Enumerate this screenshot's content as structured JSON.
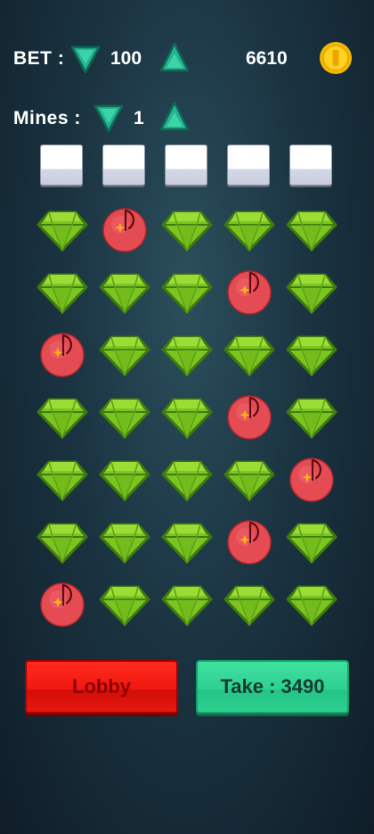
{
  "bet": {
    "label": "BET :",
    "value": "100"
  },
  "balance": {
    "value": "6610"
  },
  "mines": {
    "label": "Mines :",
    "value": "1"
  },
  "top_slots": 5,
  "grid": {
    "columns": 5,
    "rows": [
      [
        "gem",
        "mine",
        "gem",
        "gem",
        "gem"
      ],
      [
        "gem",
        "gem",
        "gem",
        "mine",
        "gem"
      ],
      [
        "mine",
        "gem",
        "gem",
        "gem",
        "gem"
      ],
      [
        "gem",
        "gem",
        "gem",
        "mine",
        "gem"
      ],
      [
        "gem",
        "gem",
        "gem",
        "gem",
        "mine"
      ],
      [
        "gem",
        "gem",
        "gem",
        "mine",
        "gem"
      ],
      [
        "mine",
        "gem",
        "gem",
        "gem",
        "gem"
      ]
    ]
  },
  "buttons": {
    "lobby": "Lobby",
    "take": "Take : 3490"
  },
  "colors": {
    "gem": "#7cc520",
    "gem_dark": "#3e7a10",
    "mine": "#e54b52",
    "arrow": "#2ec29a",
    "coin": "#ffc400",
    "lobby": "#f01810",
    "take": "#2ed091"
  }
}
